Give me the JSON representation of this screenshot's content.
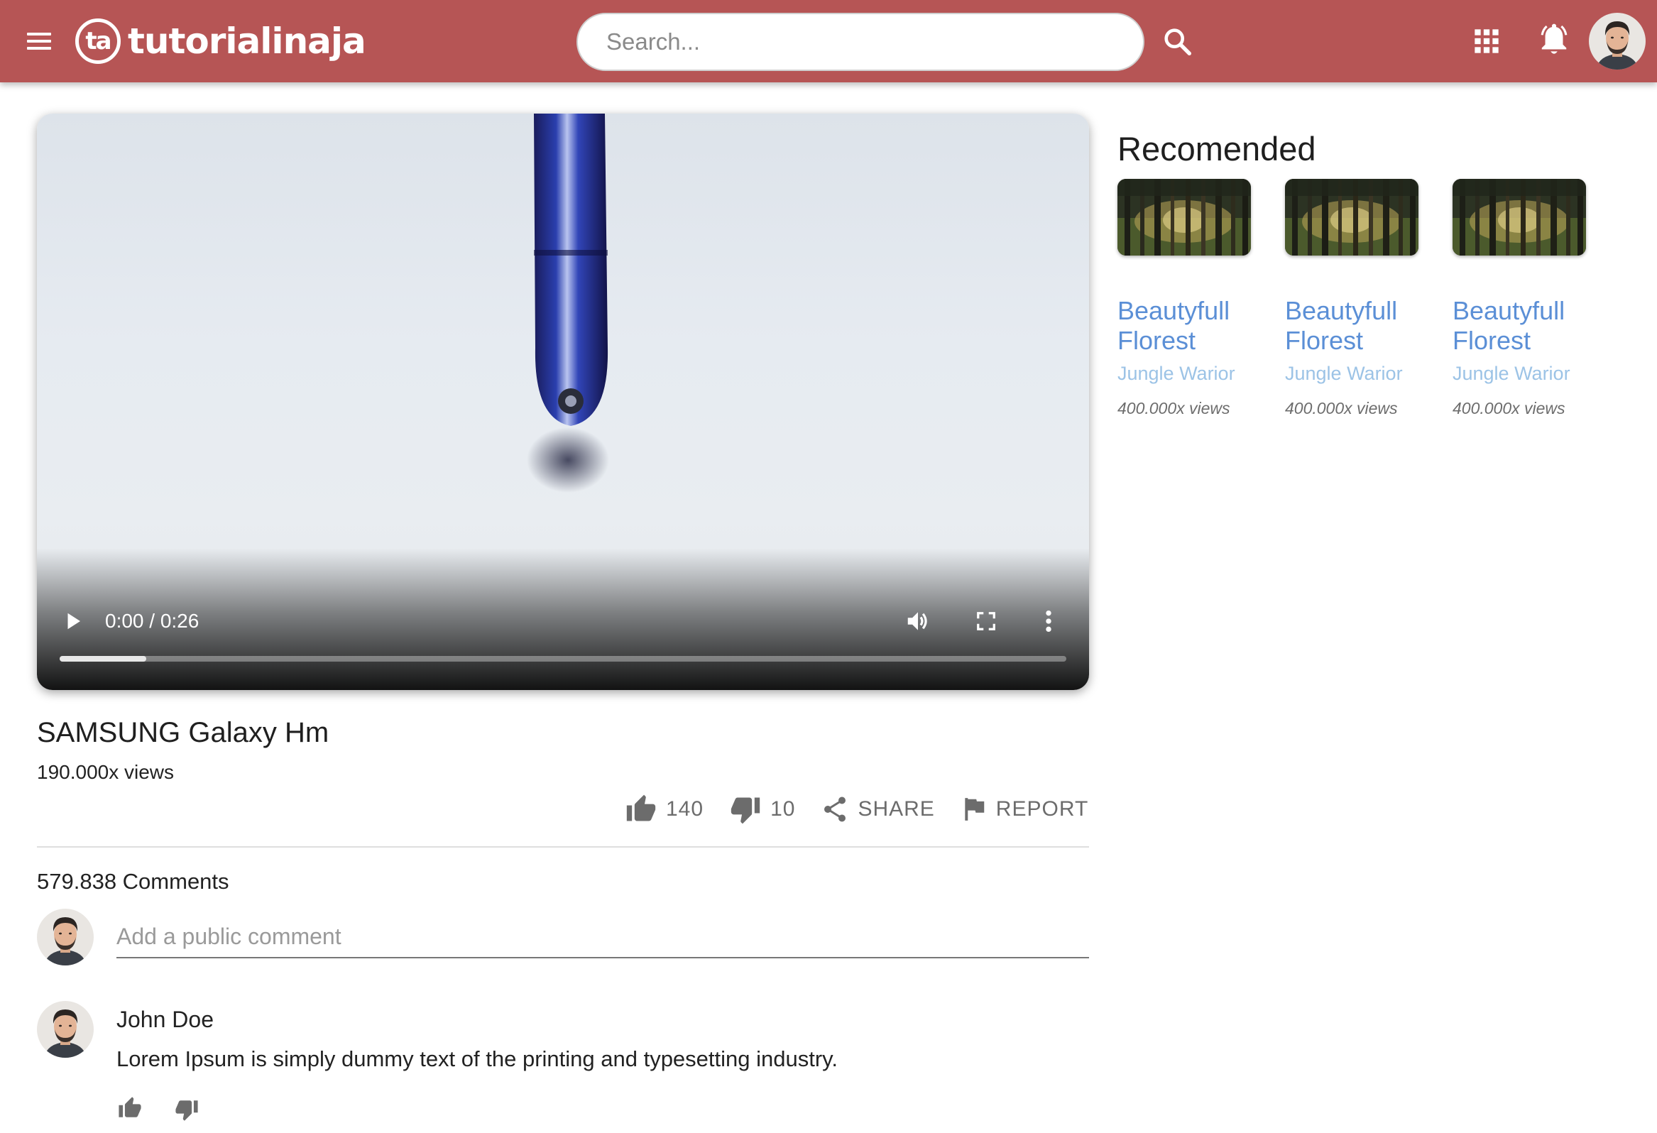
{
  "brand": {
    "mark": "ta",
    "name": "tutorialinaja"
  },
  "header": {
    "search_placeholder": "Search..."
  },
  "video": {
    "time": "0:00 / 0:26",
    "progress": 0.086,
    "title": "SAMSUNG Galaxy Hm",
    "views": "190.000x views",
    "likes": "140",
    "dislikes": "10",
    "share_label": "SHARE",
    "report_label": "REPORT"
  },
  "comments": {
    "count": "579.838 Comments",
    "placeholder": "Add a public comment",
    "items": [
      {
        "author": "John Doe",
        "text": "Lorem Ipsum is simply dummy text of the printing and typesetting industry."
      }
    ]
  },
  "recommended": {
    "title": "Recomended",
    "items": [
      {
        "name": "Beautyfull Florest",
        "channel": "Jungle Warior",
        "views": "400.000x views"
      },
      {
        "name": "Beautyfull Florest",
        "channel": "Jungle Warior",
        "views": "400.000x views"
      },
      {
        "name": "Beautyfull Florest",
        "channel": "Jungle Warior",
        "views": "400.000x views"
      }
    ]
  },
  "colors": {
    "header": "#b65555",
    "link": "#5b8fd6",
    "channel": "#9cc3e6"
  },
  "icons": [
    "menu-icon",
    "search-icon",
    "apps-grid-icon",
    "bell-icon",
    "play-icon",
    "volume-icon",
    "fullscreen-icon",
    "more-vert-icon",
    "thumb-up-icon",
    "thumb-down-icon",
    "share-icon",
    "flag-icon"
  ]
}
